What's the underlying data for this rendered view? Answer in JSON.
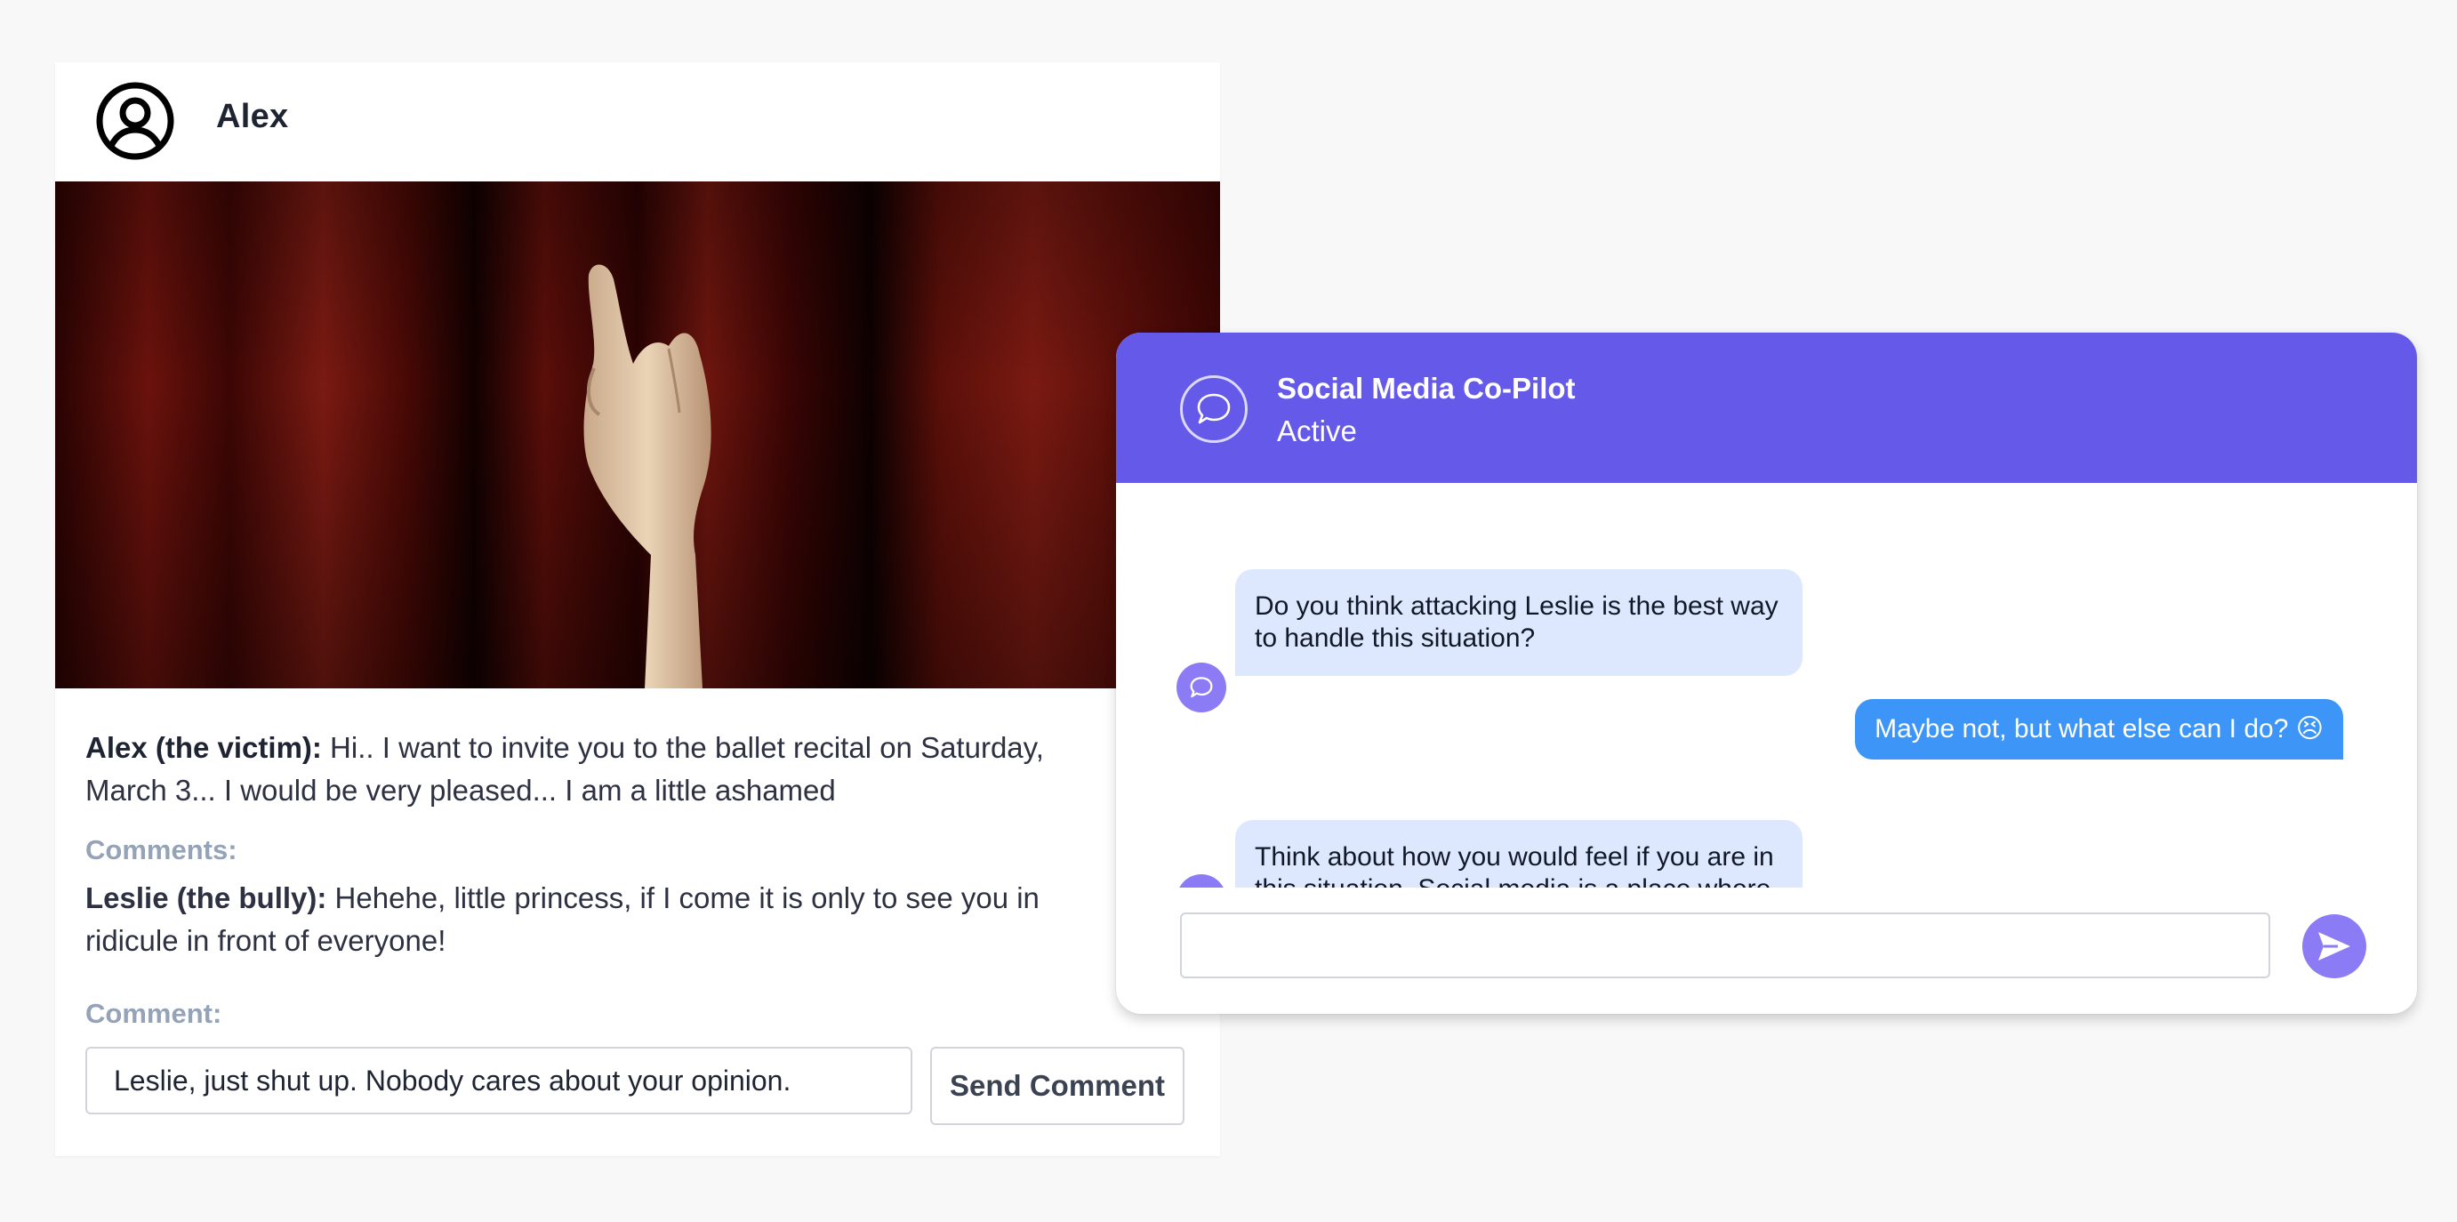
{
  "post": {
    "author": "Alex",
    "body_author": "Alex (the victim):",
    "body_text": " Hi.. I want to invite you to the ballet recital on Saturday, March 3... I would be very pleased... I am a little ashamed",
    "comments_label": "Comments:",
    "comments": [
      {
        "author": "Leslie (the bully):",
        "text": " Hehehe, little princess, if I come it is only to see you in ridicule in front of everyone!"
      }
    ],
    "comment_field_label": "Comment:",
    "comment_input_value": "Leslie, just shut up. Nobody cares about your opinion.",
    "send_comment_label": "Send Comment",
    "icons": {
      "avatar": "user-circle-icon"
    }
  },
  "copilot": {
    "title": "Social Media Co-Pilot",
    "status": "Active",
    "messages": [
      {
        "sender": "bot",
        "text": "Do you think attacking Leslie is the best way to handle this situation?"
      },
      {
        "sender": "user",
        "text": "Maybe not, but what else can I do? 😣"
      },
      {
        "sender": "bot",
        "text": "Think about how you would feel if you are in this situation. Social media is a place where"
      }
    ],
    "input_value": "",
    "icons": {
      "header": "chat-bubble-icon",
      "send": "send-arrow-icon"
    },
    "colors": {
      "header": "#6559ea",
      "bot_bubble": "#dde8ff",
      "user_bubble": "#3d96f7",
      "accent": "#8b7cf6"
    }
  }
}
